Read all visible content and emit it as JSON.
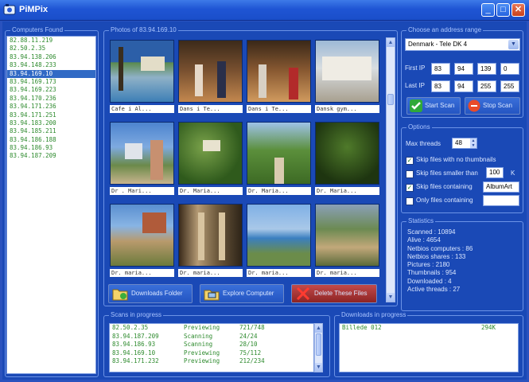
{
  "window": {
    "title": "PiMPix",
    "minimize_label": "_",
    "maximize_label": "□",
    "close_label": "✕"
  },
  "computers": {
    "label": "Computers Found",
    "items": [
      "82.88.11.219",
      "82.50.2.35",
      "83.94.138.206",
      "83.94.148.233",
      "83.94.169.10",
      "83.94.169.173",
      "83.94.169.223",
      "83.94.170.236",
      "83.94.171.236",
      "83.94.171.251",
      "83.94.183.200",
      "83.94.185.211",
      "83.94.186.188",
      "83.94.186.93",
      "83.94.187.209"
    ],
    "selected_index": 4
  },
  "photos": {
    "label": "Photos of 83.94.169.10",
    "captions": [
      "Cafe i Al...",
      "Dans i Te...",
      "Dans i Te...",
      "Dansk gym...",
      "Dr . Mari...",
      "Dr. Maria...",
      "Dr. Maria...",
      "Dr. Maria...",
      "Dr. maria...",
      "Dr. maria...",
      "Dr. maria...",
      "Dr. maria..."
    ],
    "buttons": {
      "downloads": "Downloads Folder",
      "explore": "Explore Computer",
      "delete": "Delete These Files"
    }
  },
  "address": {
    "label": "Choose an address range",
    "range": "Denmark - Tele DK 4",
    "first_ip_label": "First IP",
    "first_ip": [
      "83",
      "94",
      "139",
      "0"
    ],
    "last_ip_label": "Last IP",
    "last_ip": [
      "83",
      "94",
      "255",
      "255"
    ],
    "start_label": "Start Scan",
    "stop_label": "Stop Scan"
  },
  "options": {
    "label": "Options",
    "max_threads_label": "Max threads",
    "max_threads": "48",
    "skip_no_thumbs": {
      "label": "Skip files with no thumbnails",
      "checked": true
    },
    "skip_smaller": {
      "label": "Skip files smaller than",
      "value": "100",
      "unit": "K",
      "checked": false
    },
    "skip_containing": {
      "label": "Skip files containing",
      "value": "AlbumArt",
      "checked": true
    },
    "only_containing": {
      "label": "Only files containing",
      "value": "",
      "checked": false
    }
  },
  "statistics": {
    "label": "Statistics",
    "rows": [
      "Scanned : 10894",
      "Alive : 4654",
      "Netbios computers : 86",
      "Netbios shares : 133",
      "Pictures : 2180",
      "Thumbnails : 954",
      "Downloaded : 4",
      "Active threads : 27"
    ]
  },
  "scans": {
    "label": "Scans in progress",
    "rows": [
      {
        "ip": "82.50.2.35",
        "status": "Previewing",
        "progress": "721/748"
      },
      {
        "ip": "83.94.187.209",
        "status": "Scanning",
        "progress": "24/24"
      },
      {
        "ip": "83.94.186.93",
        "status": "Scanning",
        "progress": "28/10"
      },
      {
        "ip": "83.94.169.10",
        "status": "Previewing",
        "progress": "75/112"
      },
      {
        "ip": "83.94.171.232",
        "status": "Previewing",
        "progress": "212/234"
      }
    ]
  },
  "downloads": {
    "label": "Downloads in progress",
    "rows": [
      {
        "name": "Billede 012",
        "size": "294K"
      }
    ]
  },
  "icons": [
    "app-icon",
    "check-icon",
    "stop-icon",
    "folder-icon",
    "computer-icon",
    "delete-icon"
  ],
  "colors": {
    "accent": "#1a49b6",
    "list_text": "#2d8a2d",
    "selection": "#316ac5"
  }
}
